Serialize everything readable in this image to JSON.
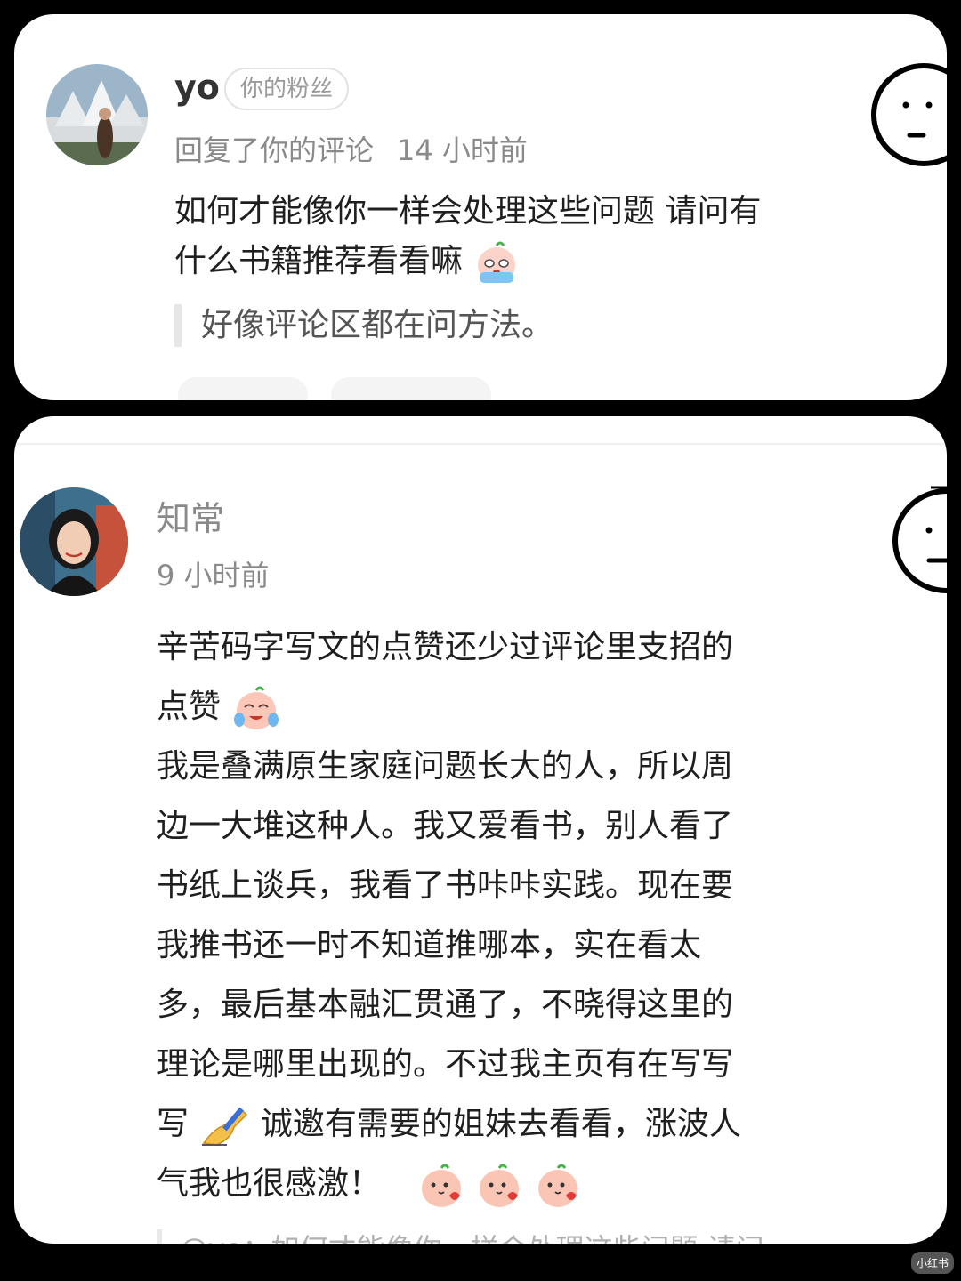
{
  "comment1": {
    "username": "yo",
    "badge": "你的粉丝",
    "action": "回复了你的评论",
    "time": "14 小时前",
    "text_line1": "如何才能像你一样会处理这些问题 请问有",
    "text_line2": "什么书籍推荐看看嘛",
    "quote": "好像评论区都在问方法。"
  },
  "comment2": {
    "username": "知常",
    "time": "9 小时前",
    "lines": [
      "辛苦码字写文的点赞还少过评论里支招的",
      "点赞",
      "我是叠满原生家庭问题长大的人，所以周",
      "边一大堆这种人。我又爱看书，别人看了",
      "书纸上谈兵，我看了书咔咔实践。现在要",
      "我推书还一时不知道推哪本，实在看太",
      "多，最后基本融汇贯通了，不晓得这里的",
      "理论是哪里出现的。不过我主页有在写写",
      "写",
      "诚邀有需要的姐妹去看看，涨波人",
      "气我也很感激！"
    ],
    "reply_ref": "@yo：如何才能像你一样会处理这些问题 请问…"
  },
  "watermark": "小红书",
  "colors": {
    "background": "#000000",
    "card": "#ffffff",
    "muted_text": "#8a8a8a",
    "body_text": "#1f1f1f"
  },
  "icons": {
    "face_sticker": "doodle-face-icon",
    "crying_emoji": "crying-peach-emoji",
    "laugh_cry_emoji": "laugh-cry-peach-emoji",
    "writing_hand": "writing-hand-emoji",
    "blush_emoji": "blush-peach-emoji"
  }
}
